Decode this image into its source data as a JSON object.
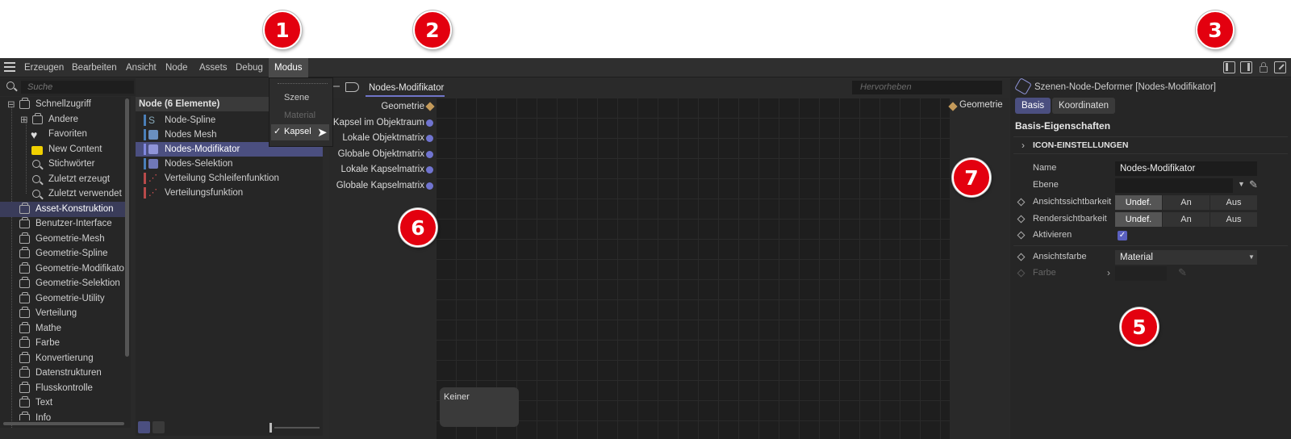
{
  "badges": {
    "b1": "1",
    "b2": "2",
    "b3": "3",
    "b5": "5",
    "b6": "6",
    "b7": "7"
  },
  "menubar": {
    "items": [
      "Erzeugen",
      "Bearbeiten",
      "Ansicht",
      "Node",
      "Assets",
      "Debug",
      "Modus"
    ],
    "active": "Modus"
  },
  "modus_menu": {
    "items": [
      "Szene",
      "Material",
      "Kapsel"
    ],
    "checked": "Kapsel",
    "disabled": "Material"
  },
  "search": {
    "placeholder": "Suche"
  },
  "tree": {
    "items": [
      "Schnellzugriff",
      "Andere",
      "Favoriten",
      "New Content",
      "Stichwörter",
      "Zuletzt erzeugt",
      "Zuletzt verwendet",
      "Asset-Konstruktion",
      "Benutzer-Interface",
      "Geometrie-Mesh",
      "Geometrie-Spline",
      "Geometrie-Modifikato",
      "Geometrie-Selektion",
      "Geometrie-Utility",
      "Verteilung",
      "Mathe",
      "Farbe",
      "Konvertierung",
      "Datenstrukturen",
      "Flusskontrolle",
      "Text",
      "Info"
    ],
    "selected": "Asset-Konstruktion"
  },
  "nodelist": {
    "header": "Node (6 Elemente)",
    "items": [
      "Node-Spline",
      "Nodes Mesh",
      "Nodes-Modifikator",
      "Nodes-Selektion",
      "Verteilung Schleifenfunktion",
      "Verteilungsfunktion"
    ],
    "selected": "Nodes-Modifikator"
  },
  "graph": {
    "tab": "Nodes-Modifikator",
    "highlight_placeholder": "Hervorheben",
    "input_ports": [
      "Geometrie",
      "Kapsel im Objektraum",
      "Lokale Objektmatrix",
      "Globale Objektmatrix",
      "Lokale Kapselmatrix",
      "Globale Kapselmatrix"
    ],
    "output_ports": [
      "Geometrie"
    ],
    "bottom_node": "Keiner"
  },
  "attributes": {
    "title": "Szenen-Node-Deformer [Nodes-Modifikator]",
    "tabs": [
      "Basis",
      "Koordinaten"
    ],
    "section": "Basis-Eigenschaften",
    "subsection": "ICON-EINSTELLUNGEN",
    "name_label": "Name",
    "name_value": "Nodes-Modifikator",
    "layer_label": "Ebene",
    "view_vis_label": "Ansichtssichtbarkeit",
    "render_vis_label": "Rendersichtbarkeit",
    "seg": [
      "Undef.",
      "An",
      "Aus"
    ],
    "enable_label": "Aktivieren",
    "color_label": "Ansichtsfarbe",
    "color_value": "Material",
    "farbe_label": "Farbe"
  },
  "colors": {
    "accent": "#4b4f80",
    "badge": "#e3000f",
    "port_dot": "#7074d0",
    "port_geo": "#c49a5a"
  }
}
